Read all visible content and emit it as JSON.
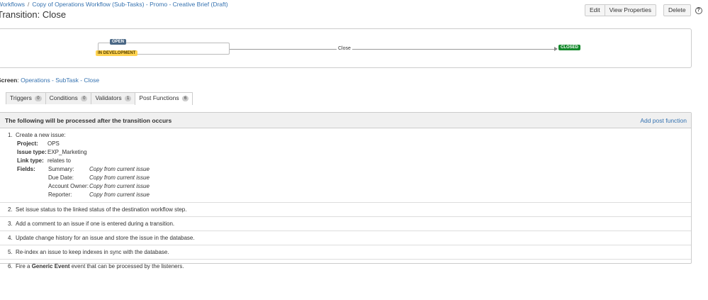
{
  "breadcrumb": {
    "root": "Workflows",
    "separator": "/",
    "workflow": "Copy of Operations Workflow (Sub-Tasks) - Promo - Creative Brief (Draft)"
  },
  "page_title": "Transition: Close",
  "actions": {
    "edit": "Edit",
    "view_properties": "View Properties",
    "delete": "Delete",
    "help": "?"
  },
  "diagram": {
    "source_open": "OPEN",
    "source_in_dev": "IN DEVELOPMENT",
    "transition": "Close",
    "target": "CLOSED"
  },
  "screen": {
    "label": "Screen",
    "colon": ":",
    "value": "Operations - SubTask - Close"
  },
  "tabs": [
    {
      "label": "Triggers",
      "count": "0"
    },
    {
      "label": "Conditions",
      "count": "0"
    },
    {
      "label": "Validators",
      "count": "1"
    },
    {
      "label": "Post Functions",
      "count": "6"
    }
  ],
  "panel": {
    "title": "The following will be processed after the transition occurs",
    "add_link": "Add post function"
  },
  "post_functions": {
    "f1": {
      "num": "1.",
      "text": "Create a new issue:",
      "project_label": "Project:",
      "project_value": "OPS",
      "issue_type_label": "Issue type:",
      "issue_type_value": "EXP_Marketing",
      "link_type_label": "Link type:",
      "link_type_value": "relates to",
      "fields_label": "Fields:",
      "fields": [
        {
          "name": "Summary:",
          "value": "Copy from current issue"
        },
        {
          "name": "Due Date:",
          "value": "Copy from current issue"
        },
        {
          "name": "Account Owner:",
          "value": "Copy from current issue"
        },
        {
          "name": "Reporter:",
          "value": "Copy from current issue"
        }
      ]
    },
    "f2": {
      "num": "2.",
      "text": "Set issue status to the linked status of the destination workflow step."
    },
    "f3": {
      "num": "3.",
      "text": "Add a comment to an issue if one is entered during a transition."
    },
    "f4": {
      "num": "4.",
      "text": "Update change history for an issue and store the issue in the database."
    },
    "f5": {
      "num": "5.",
      "text": "Re-index an issue to keep indexes in sync with the database."
    },
    "f6": {
      "num": "6.",
      "pre": "Fire a",
      "event": "Generic Event",
      "post": "event that can be processed by the listeners."
    }
  },
  "colors": {
    "link": "#3572b0",
    "open_lozenge": "#4a6785",
    "in_dev_lozenge": "#ffd351",
    "closed_lozenge": "#14892c"
  }
}
